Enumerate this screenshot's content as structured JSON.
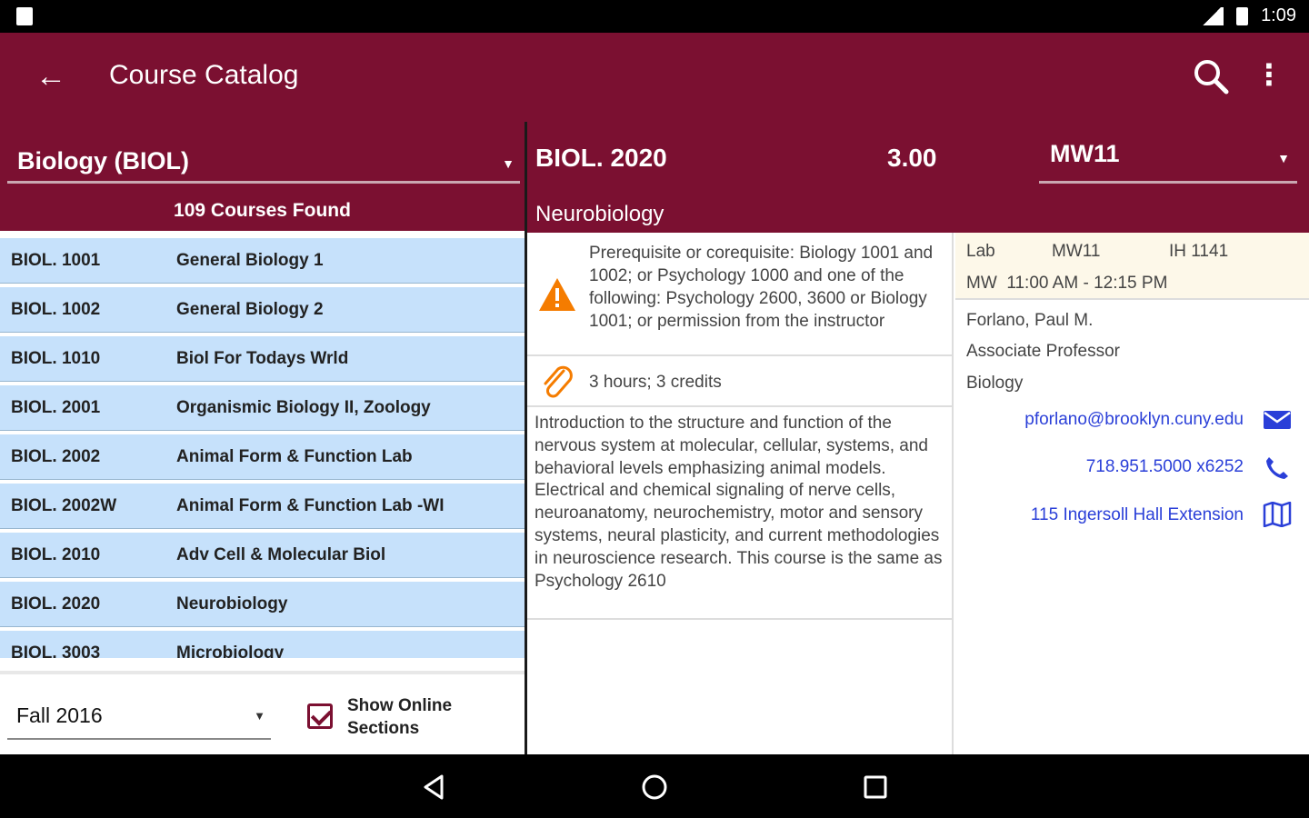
{
  "status_bar": {
    "time": "1:09"
  },
  "app_bar": {
    "back_icon": "arrow-left-icon",
    "title": "Course Catalog",
    "search_icon": "search-icon",
    "more_icon": "more-vertical-icon"
  },
  "subject_select": {
    "value": "Biology (BIOL)"
  },
  "courses_found": "109 Courses Found",
  "courses": [
    {
      "code": "BIOL. 1001",
      "name": "General Biology 1"
    },
    {
      "code": "BIOL. 1002",
      "name": "General Biology 2"
    },
    {
      "code": "BIOL. 1010",
      "name": "Biol For Todays Wrld"
    },
    {
      "code": "BIOL. 2001",
      "name": "Organismic Biology II, Zoology"
    },
    {
      "code": "BIOL. 2002",
      "name": "Animal Form & Function Lab"
    },
    {
      "code": "BIOL. 2002W",
      "name": "Animal Form & Function Lab -WI"
    },
    {
      "code": "BIOL. 2010",
      "name": "Adv Cell & Molecular Biol"
    },
    {
      "code": "BIOL. 2020",
      "name": "Neurobiology"
    },
    {
      "code": "BIOL. 3003",
      "name": "Microbiology"
    }
  ],
  "term_select": {
    "value": "Fall 2016"
  },
  "show_online": {
    "label": "Show Online Sections",
    "checked": true
  },
  "detail": {
    "code": "BIOL. 2020",
    "credits": "3.00",
    "title": "Neurobiology",
    "section": "MW11",
    "prerequisite": "Prerequisite or corequisite: Biology 1001 and 1002; or Psychology 1000 and one of the following: Psychology 2600, 3600 or Biology 1001; or permission from the instructor",
    "hours": "3 hours; 3 credits",
    "description": "Introduction to the structure and function of the nervous system at molecular, cellular, systems, and behavioral levels emphasizing animal models. Electrical and chemical signaling of nerve cells, neuroanatomy, neurochemistry, motor and sensory systems, neural plasticity, and current methodologies in neuroscience research. This course is the same as Psychology 2610"
  },
  "meeting": {
    "type": "Lab",
    "section": "MW11",
    "room": "IH 1141",
    "time": "MW  11:00 AM - 12:15 PM"
  },
  "instructor": {
    "name": "Forlano, Paul M.",
    "title": "Associate Professor",
    "department": "Biology",
    "email": "pforlano@brooklyn.cuny.edu",
    "phone": "718.951.5000 x6252",
    "office": "115 Ingersoll Hall Extension"
  },
  "colors": {
    "primary": "#7b1031",
    "row": "#c6e1fb",
    "link": "#2a3fd8",
    "warning": "#f57c00",
    "meeting_bg": "#fdf8e9"
  }
}
